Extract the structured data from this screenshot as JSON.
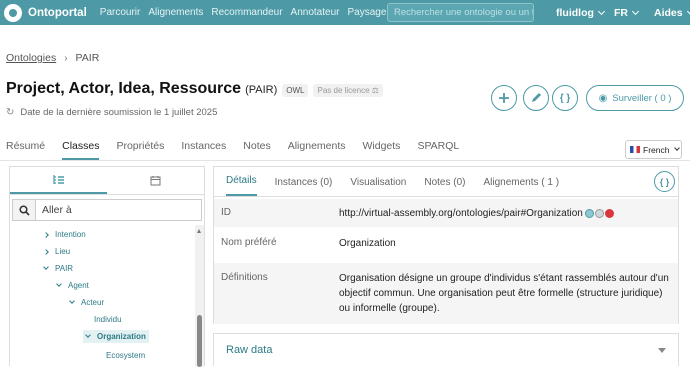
{
  "topbar": {
    "brand": "Ontoportal",
    "nav": [
      "Parcourir",
      "Alignements",
      "Recommandeur",
      "Annotateur",
      "Paysage"
    ],
    "search_placeholder": "Rechercher une ontologie ou un terme",
    "user": "fluidlog",
    "language": "FR",
    "help": "Aides"
  },
  "breadcrumb": {
    "root": "Ontologies",
    "current": "PAIR"
  },
  "ontology": {
    "title": "Project, Actor, Idea, Ressource",
    "acronym": "(PAIR)",
    "format": "OWL",
    "license": "Pas de licence",
    "submission": "Date de la dernière soumission le 1 juillet 2025",
    "subscribe": "Surveiller ( 0 )"
  },
  "main_tabs": [
    "Résumé",
    "Classes",
    "Propriétés",
    "Instances",
    "Notes",
    "Alignements",
    "Widgets",
    "SPARQL"
  ],
  "active_main_tab": "Classes",
  "lang_select": "French",
  "tree": {
    "search_placeholder": "Aller à",
    "items": [
      "Intention",
      "Lieu",
      "PAIR",
      "Agent",
      "Acteur",
      "Individu",
      "Organization",
      "Ecosystem"
    ]
  },
  "detail": {
    "tabs": [
      "Détails",
      "Instances (0)",
      "Visualisation",
      "Notes (0)",
      "Alignements ( 1 )"
    ],
    "json_label": "{ }",
    "id_label": "ID",
    "id_value": "http://virtual-assembly.org/ontologies/pair#Organization",
    "pref_label": "Nom préféré",
    "pref_value": "Organization",
    "def_label": "Définitions",
    "def_value": "Organisation désigne un groupe d'individus s'étant rassemblés autour d'un objectif commun. Une organisation peut être formelle (structure juridique) ou informelle (groupe)."
  },
  "raw": {
    "label": "Raw data"
  },
  "colors": {
    "brand": "#4d9aa6",
    "link": "#2d7a86"
  }
}
